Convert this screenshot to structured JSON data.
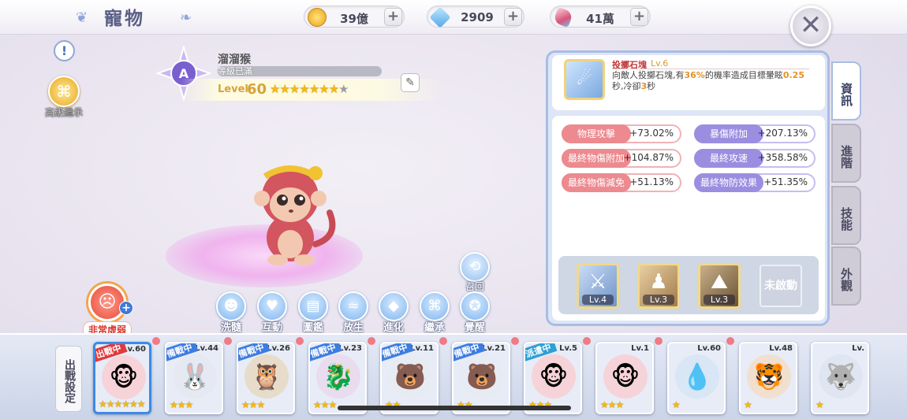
{
  "header": {
    "title": "寵物",
    "resources": [
      {
        "icon": "gold-coin-icon",
        "value": "39億",
        "color": "#f0b530"
      },
      {
        "icon": "diamond-icon",
        "value": "2909",
        "color": "#5fb8f0"
      },
      {
        "icon": "crystal-icon",
        "value": "41萬",
        "color": "#e46a8a"
      }
    ],
    "plus_label": "+",
    "close_label": "✕"
  },
  "left": {
    "info_label": "!",
    "inherit_label": "高級繼承",
    "mood_label": "非常虛弱"
  },
  "pet": {
    "rank": "A",
    "name": "溜溜猴",
    "status": "等級已滿",
    "level_word": "Level",
    "level": "60",
    "stars_filled": 7,
    "stars_total": 8
  },
  "actions": [
    {
      "icon": "robot-icon",
      "label": "洗髓",
      "glyph": "☻"
    },
    {
      "icon": "heart-icon",
      "label": "互動",
      "glyph": "♥"
    },
    {
      "icon": "book-icon",
      "label": "圖鑑",
      "glyph": "▤"
    },
    {
      "icon": "fish-icon",
      "label": "放生",
      "glyph": "≈"
    },
    {
      "icon": "crystal-evolve-icon",
      "label": "進化",
      "glyph": "◆"
    },
    {
      "icon": "dna-icon",
      "label": "繼承",
      "glyph": "⌘"
    },
    {
      "icon": "awaken-icon",
      "label": "覺醒",
      "glyph": "✪"
    }
  ],
  "recall_label": "召回",
  "skill": {
    "name": "投擲石塊",
    "level": "Lv.6",
    "desc_1": "向敵人投擲石塊,有",
    "desc_pct": "36%",
    "desc_2": "的機率造成目標暈眩",
    "desc_sec": "0.25",
    "desc_3": "秒,冷卻",
    "desc_cd": "3",
    "desc_4": "秒"
  },
  "stats": [
    {
      "name": "物理攻擊",
      "value": "+73.02%",
      "color": "pink"
    },
    {
      "name": "暴傷附加",
      "value": "+207.13%",
      "color": "purple"
    },
    {
      "name": "最終物傷附加",
      "value": "+104.87%",
      "color": "pink"
    },
    {
      "name": "最終攻速",
      "value": "+358.58%",
      "color": "purple"
    },
    {
      "name": "最終物傷減免",
      "value": "+51.13%",
      "color": "pink"
    },
    {
      "name": "最終物防效果",
      "value": "+51.35%",
      "color": "purple"
    }
  ],
  "runes": [
    {
      "icon": "sword-rune-icon",
      "level": "Lv.4"
    },
    {
      "icon": "person-rune-icon",
      "level": "Lv.3"
    },
    {
      "icon": "mountain-rune-icon",
      "level": "Lv.3"
    }
  ],
  "unlock_label": "未啟動",
  "tabs": [
    "資訊",
    "進階",
    "技能",
    "外觀"
  ],
  "deploy_label": "出戰設定",
  "roster": [
    {
      "level": "Lv.60",
      "status": "出戰中",
      "status_type": "out",
      "stars": 6,
      "emoji": "🐵"
    },
    {
      "level": "Lv.44",
      "status": "備戰中",
      "status_type": "stby",
      "stars": 3,
      "emoji": "🐰"
    },
    {
      "level": "Lv.26",
      "status": "備戰中",
      "status_type": "stby",
      "stars": 3,
      "emoji": "🦉"
    },
    {
      "level": "Lv.23",
      "status": "備戰中",
      "status_type": "stby",
      "stars": 3,
      "emoji": "🐉"
    },
    {
      "level": "Lv.11",
      "status": "備戰中",
      "status_type": "stby",
      "stars": 2,
      "emoji": "🐻"
    },
    {
      "level": "Lv.21",
      "status": "備戰中",
      "status_type": "stby",
      "stars": 2,
      "emoji": "🐻"
    },
    {
      "level": "Lv.5",
      "status": "派遣中",
      "status_type": "sent",
      "stars": 3,
      "emoji": "🐵"
    },
    {
      "level": "Lv.1",
      "status": "",
      "status_type": "",
      "stars": 3,
      "emoji": "🐵"
    },
    {
      "level": "Lv.60",
      "status": "",
      "status_type": "",
      "stars": 1,
      "emoji": "💧"
    },
    {
      "level": "Lv.48",
      "status": "",
      "status_type": "",
      "stars": 1,
      "emoji": "🐯"
    },
    {
      "level": "Lv.",
      "status": "",
      "status_type": "",
      "stars": 1,
      "emoji": "🐺"
    }
  ]
}
